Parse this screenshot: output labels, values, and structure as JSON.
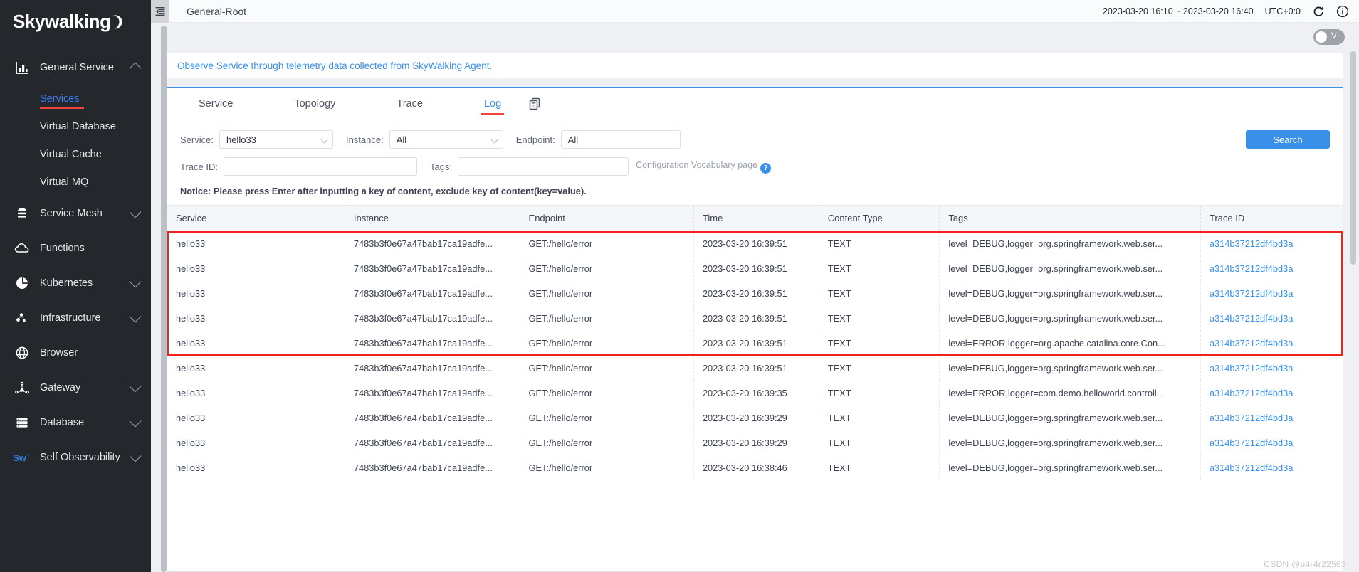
{
  "brand": {
    "name": "Skywalking",
    "moon_icon": "crescent-moon-icon"
  },
  "sidebar": {
    "groups": [
      {
        "label": "General Service",
        "icon": "chart-bar-icon",
        "expanded": true,
        "chevron": "chevron-up-icon",
        "children": [
          {
            "label": "Services",
            "active": true
          },
          {
            "label": "Virtual Database",
            "active": false
          },
          {
            "label": "Virtual Cache",
            "active": false
          },
          {
            "label": "Virtual MQ",
            "active": false
          }
        ]
      },
      {
        "label": "Service Mesh",
        "icon": "layers-icon",
        "expanded": false,
        "chevron": "chevron-down-icon",
        "children": []
      },
      {
        "label": "Functions",
        "icon": "cloud-icon",
        "expanded": false,
        "chevron": "",
        "children": []
      },
      {
        "label": "Kubernetes",
        "icon": "kubernetes-icon",
        "expanded": false,
        "chevron": "chevron-down-icon",
        "children": []
      },
      {
        "label": "Infrastructure",
        "icon": "nodes-icon",
        "expanded": false,
        "chevron": "chevron-down-icon",
        "children": []
      },
      {
        "label": "Browser",
        "icon": "globe-icon",
        "expanded": false,
        "chevron": "",
        "children": []
      },
      {
        "label": "Gateway",
        "icon": "gateway-icon",
        "expanded": false,
        "chevron": "chevron-down-icon",
        "children": []
      },
      {
        "label": "Database",
        "icon": "database-icon",
        "expanded": false,
        "chevron": "chevron-down-icon",
        "children": []
      },
      {
        "label": "Self Observability",
        "icon": "skywalking-sw-icon",
        "expanded": false,
        "chevron": "chevron-down-icon",
        "children": []
      }
    ]
  },
  "topbar": {
    "collapse_icon": "collapse-sidebar-icon",
    "breadcrumb": "General-Root",
    "time_range": "2023-03-20 16:10 ~ 2023-03-20 16:40",
    "timezone": "UTC+0:0",
    "refresh_icon": "refresh-icon",
    "info_icon": "info-circle-icon"
  },
  "view_toggle": {
    "label": "V",
    "enabled": false
  },
  "notice_link": "Observe Service through telemetry data collected from SkyWalking Agent.",
  "tabs": [
    {
      "label": "Service",
      "active": false
    },
    {
      "label": "Topology",
      "active": false
    },
    {
      "label": "Trace",
      "active": false
    },
    {
      "label": "Log",
      "active": true
    }
  ],
  "tab_action_icon": "copy-duplicate-icon",
  "filters": {
    "service_label": "Service:",
    "service_value": "hello33",
    "instance_label": "Instance:",
    "instance_value": "All",
    "endpoint_label": "Endpoint:",
    "endpoint_value": "All",
    "traceid_label": "Trace ID:",
    "traceid_value": "",
    "traceid_placeholder": "",
    "tags_label": "Tags:",
    "tags_value": "",
    "tags_placeholder": "",
    "config_link": "Configuration Vocabulary page",
    "help_badge": "?",
    "search_button": "Search",
    "notice": "Notice: Please press Enter after inputting a key of content, exclude key of content(key=value)."
  },
  "table": {
    "columns": [
      "Service",
      "Instance",
      "Endpoint",
      "Time",
      "Content Type",
      "Tags",
      "Trace ID"
    ],
    "highlight_rows": [
      0,
      1,
      2,
      3,
      4
    ],
    "rows": [
      {
        "service": "hello33",
        "instance": "7483b3f0e67a47bab17ca19adfe...",
        "endpoint": "GET:/hello/error",
        "time": "2023-03-20 16:39:51",
        "content_type": "TEXT",
        "tags": "level=DEBUG,logger=org.springframework.web.ser...",
        "trace_id": "a314b37212df4bd3a"
      },
      {
        "service": "hello33",
        "instance": "7483b3f0e67a47bab17ca19adfe...",
        "endpoint": "GET:/hello/error",
        "time": "2023-03-20 16:39:51",
        "content_type": "TEXT",
        "tags": "level=DEBUG,logger=org.springframework.web.ser...",
        "trace_id": "a314b37212df4bd3a"
      },
      {
        "service": "hello33",
        "instance": "7483b3f0e67a47bab17ca19adfe...",
        "endpoint": "GET:/hello/error",
        "time": "2023-03-20 16:39:51",
        "content_type": "TEXT",
        "tags": "level=DEBUG,logger=org.springframework.web.ser...",
        "trace_id": "a314b37212df4bd3a"
      },
      {
        "service": "hello33",
        "instance": "7483b3f0e67a47bab17ca19adfe...",
        "endpoint": "GET:/hello/error",
        "time": "2023-03-20 16:39:51",
        "content_type": "TEXT",
        "tags": "level=DEBUG,logger=org.springframework.web.ser...",
        "trace_id": "a314b37212df4bd3a"
      },
      {
        "service": "hello33",
        "instance": "7483b3f0e67a47bab17ca19adfe...",
        "endpoint": "GET:/hello/error",
        "time": "2023-03-20 16:39:51",
        "content_type": "TEXT",
        "tags": "level=ERROR,logger=org.apache.catalina.core.Con...",
        "trace_id": "a314b37212df4bd3a"
      },
      {
        "service": "hello33",
        "instance": "7483b3f0e67a47bab17ca19adfe...",
        "endpoint": "GET:/hello/error",
        "time": "2023-03-20 16:39:51",
        "content_type": "TEXT",
        "tags": "level=DEBUG,logger=org.springframework.web.ser...",
        "trace_id": "a314b37212df4bd3a"
      },
      {
        "service": "hello33",
        "instance": "7483b3f0e67a47bab17ca19adfe...",
        "endpoint": "GET:/hello/error",
        "time": "2023-03-20 16:39:35",
        "content_type": "TEXT",
        "tags": "level=ERROR,logger=com.demo.helloworld.controll...",
        "trace_id": "a314b37212df4bd3a"
      },
      {
        "service": "hello33",
        "instance": "7483b3f0e67a47bab17ca19adfe...",
        "endpoint": "GET:/hello/error",
        "time": "2023-03-20 16:39:29",
        "content_type": "TEXT",
        "tags": "level=DEBUG,logger=org.springframework.web.ser...",
        "trace_id": "a314b37212df4bd3a"
      },
      {
        "service": "hello33",
        "instance": "7483b3f0e67a47bab17ca19adfe...",
        "endpoint": "GET:/hello/error",
        "time": "2023-03-20 16:39:29",
        "content_type": "TEXT",
        "tags": "level=DEBUG,logger=org.springframework.web.ser...",
        "trace_id": "a314b37212df4bd3a"
      },
      {
        "service": "hello33",
        "instance": "7483b3f0e67a47bab17ca19adfe...",
        "endpoint": "GET:/hello/error",
        "time": "2023-03-20 16:38:46",
        "content_type": "TEXT",
        "tags": "level=DEBUG,logger=org.springframework.web.ser...",
        "trace_id": "a314b37212df4bd3a"
      }
    ]
  },
  "watermark": "CSDN @u4r4r22563",
  "colors": {
    "sidebar_bg": "#24272c",
    "accent_blue": "#3a90e8",
    "accent_red": "#f0433a",
    "highlight_red": "#f0241c"
  }
}
